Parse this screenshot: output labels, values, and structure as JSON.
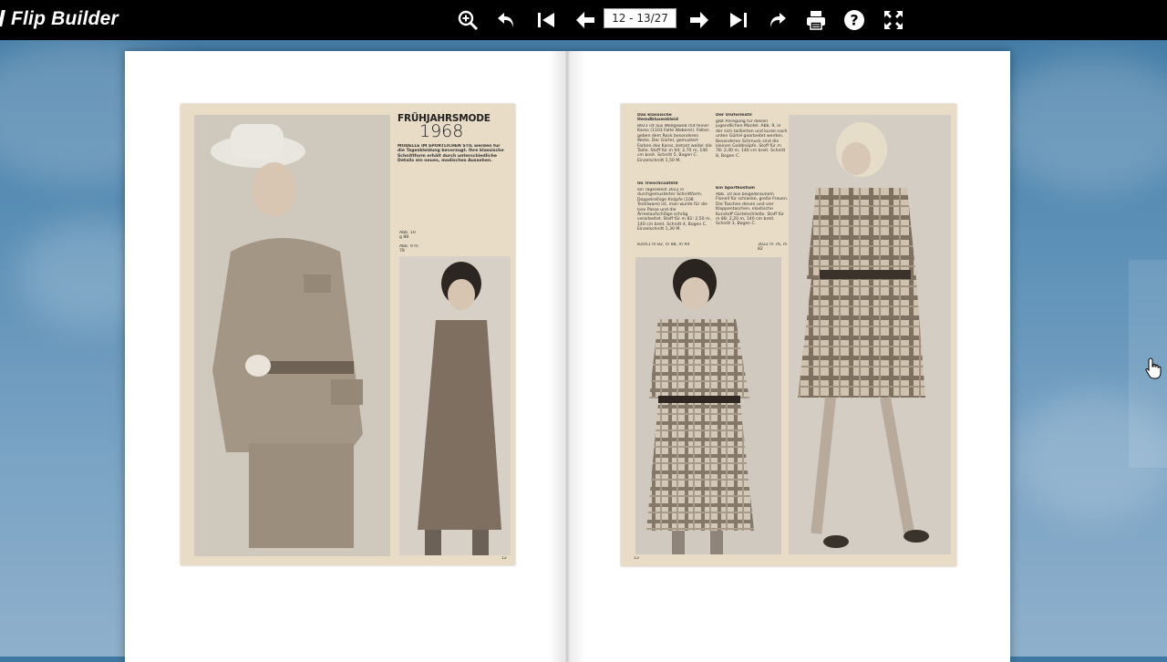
{
  "app": {
    "title": "Flip Builder"
  },
  "toolbar": {
    "page_indicator": "12 - 13/27",
    "buttons": [
      {
        "name": "zoom-in-icon"
      },
      {
        "name": "undo-icon"
      },
      {
        "name": "first-page-icon"
      },
      {
        "name": "previous-page-icon"
      },
      {
        "name": "next-page-icon"
      },
      {
        "name": "last-page-icon"
      },
      {
        "name": "share-icon"
      },
      {
        "name": "print-icon"
      },
      {
        "name": "help-icon"
      },
      {
        "name": "fullscreen-icon"
      }
    ]
  },
  "left_page": {
    "headline_top": "FRÜHJAHRSMODE",
    "headline_year": "1968",
    "intro": "MODELLE IM SPORTLICHEN STIL werden für die Tageskleidung bevorzugt. Ihre klassische Schnittform erhält durch unterschiedliche Details ein neues, modisches Aussehen.",
    "caption_a": "Abb. 10 g 88",
    "caption_b": "Abb. 9 m 78",
    "page_number": "12"
  },
  "right_page": {
    "col1_title": "Das klassische Hemdblusenkleid",
    "col1_text": "8921 ist aus Wollgeweb mit feiner Karos (1103 Falte Weberei). Falten geben dem Rock besonderen Weite. Der Gürtel, gemustert Farben des Karos, betont weiter die Taille. Stoff für m 94: 2,70 m, 140 cm breit. Schnitt 5, Bogen C. Einzelschnitt 1,50 M.",
    "col2_title": "Der Uniformstil",
    "col2_text": "gibt Anregung für diesen jugendlichen Mantel. Abb. 9, in der sich taillierten und kurze nach unten Gürtel gearbeitet werden. Besonderen Schmuck sind die kleinen Goldknöpfe. Stoff für m 78: 2,40 m, 140 cm breit. Schnitt 8, Bogen C.",
    "col3_title": "Im Trenchcoatstil",
    "col3_text": "ein Tageskleid 3022 in durchgemusterter Schnittform. Doppelreihige Knöpfe (108 Textilware) ist, man wurde für die lose Passe und die Ärmelaufschläge schräg verarbeitet. Stoff für m 82: 2,50 m, 140 cm breit. Schnitt 4, Bogen C. Einzelschnitt 1,30 M.",
    "col4_title": "Ein Sportkostüm",
    "col4_text": "Abb. 10 aus beige/braunem Flanell für schlanke, große Frauen. Die Taschen denen und vier Klappentaschen, elastische Kunstoff Gürtelschließe. Stoff für m 88: 2,20 m, 140 cm breit. Schnitt 3, Bogen C.",
    "caption_a": "83051 m 82, m 88, m 94",
    "caption_b": "3022 m 76, m 82",
    "page_number": "13"
  }
}
